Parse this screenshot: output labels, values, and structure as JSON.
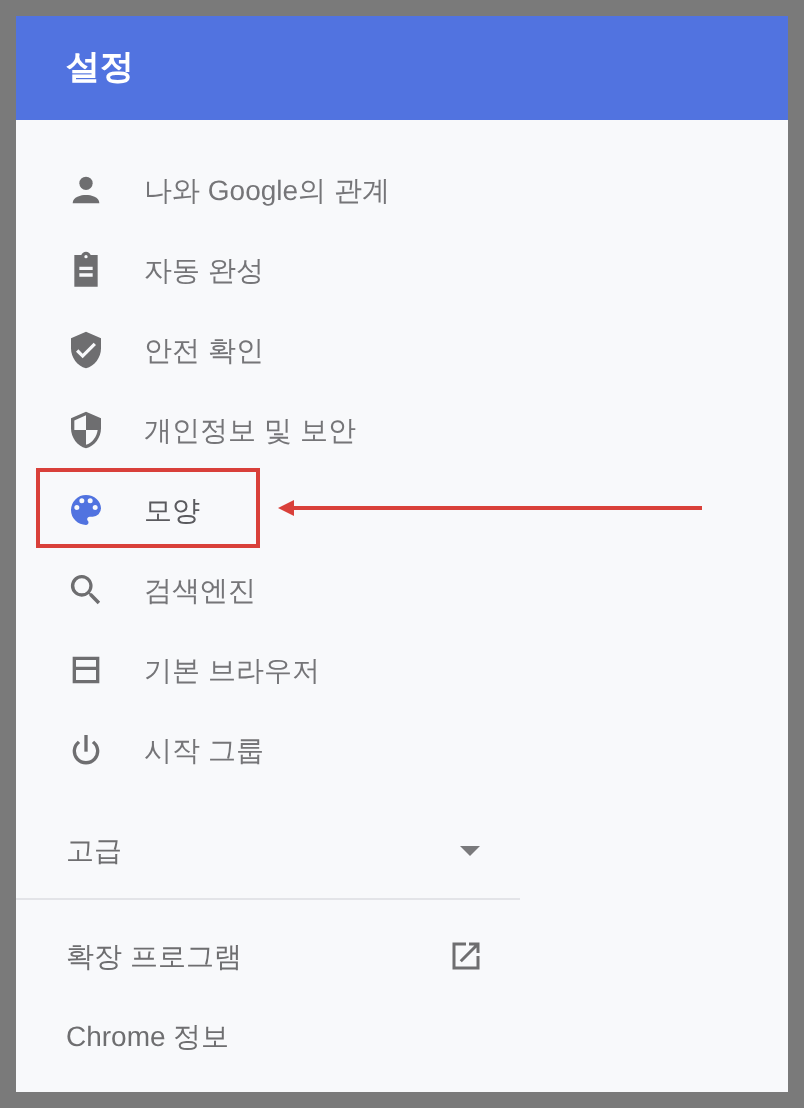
{
  "header": {
    "title": "설정"
  },
  "menu_items": [
    {
      "label": "나와 Google의 관계",
      "selected": false
    },
    {
      "label": "자동 완성",
      "selected": false
    },
    {
      "label": "안전 확인",
      "selected": false
    },
    {
      "label": "개인정보 및 보안",
      "selected": false
    },
    {
      "label": "모양",
      "selected": true
    },
    {
      "label": "검색엔진",
      "selected": false
    },
    {
      "label": "기본 브라우저",
      "selected": false
    },
    {
      "label": "시작 그룹",
      "selected": false
    }
  ],
  "advanced": {
    "label": "고급",
    "expanded": false
  },
  "footer_items": [
    {
      "label": "확장 프로그램",
      "external": true
    },
    {
      "label": "Chrome 정보",
      "external": false
    }
  ],
  "annotation": {
    "kind": "highlight-arrow"
  }
}
